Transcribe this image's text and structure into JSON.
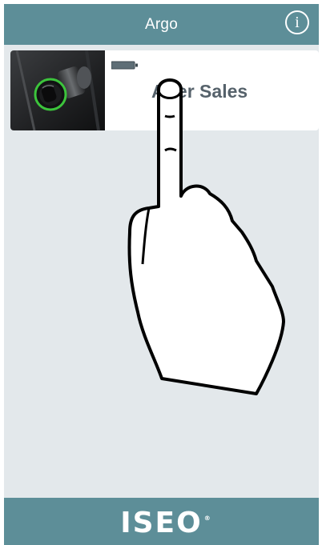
{
  "header": {
    "title": "Argo",
    "info_icon": "info-circle-icon",
    "info_glyph": "i"
  },
  "device_list": {
    "items": [
      {
        "name": "After Sales",
        "battery_icon": "battery-icon",
        "thumbnail": "smart-lock-cylinder"
      }
    ]
  },
  "footer": {
    "logo_text": "ISEO",
    "logo_mark": "®"
  },
  "overlay": {
    "icon": "tap-gesture-hand-icon"
  },
  "colors": {
    "brand": "#5d8e98",
    "background": "#e3e8eb",
    "card": "#ffffff",
    "device_name": "#56626b",
    "lock_ring": "#3cc43c"
  }
}
